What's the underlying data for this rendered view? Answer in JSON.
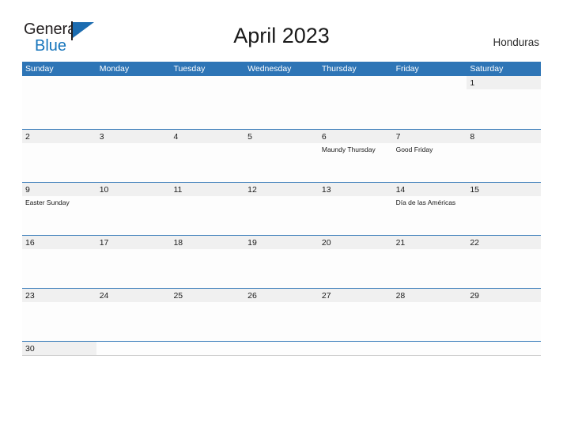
{
  "brand": {
    "name_part1": "General",
    "name_part2": "Blue",
    "flag_icon": "flag-triangle-icon",
    "color_primary": "#1574bb",
    "color_text": "#231f20"
  },
  "header": {
    "title": "April 2023",
    "country": "Honduras"
  },
  "theme": {
    "header_blue": "#2e75b6",
    "row_divider": "#2e75b6",
    "daynum_band": "#f0f0f0",
    "page_background": "#ffffff"
  },
  "calendar": {
    "month": "April",
    "year": "2023",
    "weekday_headers": [
      "Sunday",
      "Monday",
      "Tuesday",
      "Wednesday",
      "Thursday",
      "Friday",
      "Saturday"
    ],
    "weeks": [
      {
        "days": [
          {
            "num": "",
            "events": []
          },
          {
            "num": "",
            "events": []
          },
          {
            "num": "",
            "events": []
          },
          {
            "num": "",
            "events": []
          },
          {
            "num": "",
            "events": []
          },
          {
            "num": "",
            "events": []
          },
          {
            "num": "1",
            "events": []
          }
        ]
      },
      {
        "days": [
          {
            "num": "2",
            "events": []
          },
          {
            "num": "3",
            "events": []
          },
          {
            "num": "4",
            "events": []
          },
          {
            "num": "5",
            "events": []
          },
          {
            "num": "6",
            "events": [
              "Maundy Thursday"
            ]
          },
          {
            "num": "7",
            "events": [
              "Good Friday"
            ]
          },
          {
            "num": "8",
            "events": []
          }
        ]
      },
      {
        "days": [
          {
            "num": "9",
            "events": [
              "Easter Sunday"
            ]
          },
          {
            "num": "10",
            "events": []
          },
          {
            "num": "11",
            "events": []
          },
          {
            "num": "12",
            "events": []
          },
          {
            "num": "13",
            "events": []
          },
          {
            "num": "14",
            "events": [
              "Día de las Américas"
            ]
          },
          {
            "num": "15",
            "events": []
          }
        ]
      },
      {
        "days": [
          {
            "num": "16",
            "events": []
          },
          {
            "num": "17",
            "events": []
          },
          {
            "num": "18",
            "events": []
          },
          {
            "num": "19",
            "events": []
          },
          {
            "num": "20",
            "events": []
          },
          {
            "num": "21",
            "events": []
          },
          {
            "num": "22",
            "events": []
          }
        ]
      },
      {
        "days": [
          {
            "num": "23",
            "events": []
          },
          {
            "num": "24",
            "events": []
          },
          {
            "num": "25",
            "events": []
          },
          {
            "num": "26",
            "events": []
          },
          {
            "num": "27",
            "events": []
          },
          {
            "num": "28",
            "events": []
          },
          {
            "num": "29",
            "events": []
          }
        ]
      },
      {
        "days": [
          {
            "num": "30",
            "events": []
          },
          {
            "num": "",
            "events": []
          },
          {
            "num": "",
            "events": []
          },
          {
            "num": "",
            "events": []
          },
          {
            "num": "",
            "events": []
          },
          {
            "num": "",
            "events": []
          },
          {
            "num": "",
            "events": []
          }
        ]
      }
    ]
  }
}
